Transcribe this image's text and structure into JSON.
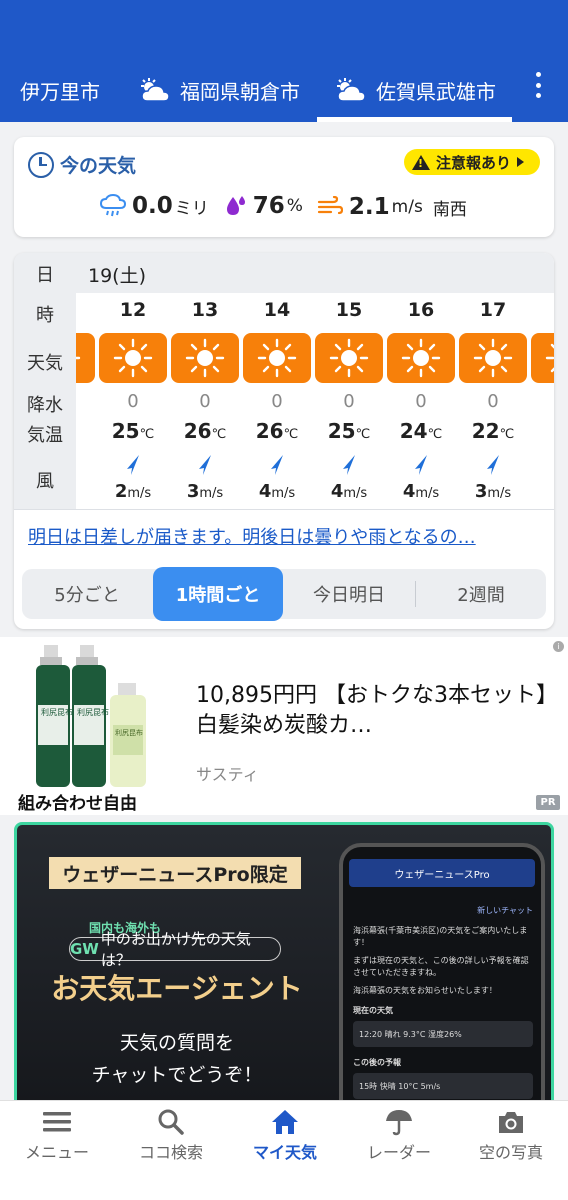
{
  "header": {
    "tabs": [
      {
        "label": "伊万里市"
      },
      {
        "label": "福岡県朝倉市"
      },
      {
        "label": "佐賀県武雄市"
      }
    ],
    "active_tab": 2,
    "accent": "#1f58c8"
  },
  "now": {
    "title": "今の天気",
    "alert": "注意報あり",
    "rain_value": "0.0",
    "rain_unit": "ミリ",
    "humidity_value": "76",
    "humidity_unit": "%",
    "wind_value": "2.1",
    "wind_unit": "m/s",
    "wind_dir": "南西"
  },
  "forecast": {
    "row_labels": {
      "day": "日",
      "hour": "時",
      "weather": "天気",
      "precip": "降水",
      "temp": "気温",
      "wind": "風"
    },
    "date": "19(土)",
    "hours": [
      {
        "hour": "12",
        "precip": "0",
        "temp": "25",
        "wind": "2",
        "icon": "sun-icon"
      },
      {
        "hour": "13",
        "precip": "0",
        "temp": "26",
        "wind": "3",
        "icon": "sun-icon"
      },
      {
        "hour": "14",
        "precip": "0",
        "temp": "26",
        "wind": "4",
        "icon": "sun-icon"
      },
      {
        "hour": "15",
        "precip": "0",
        "temp": "25",
        "wind": "4",
        "icon": "sun-icon"
      },
      {
        "hour": "16",
        "precip": "0",
        "temp": "24",
        "wind": "4",
        "icon": "sun-icon"
      },
      {
        "hour": "17",
        "precip": "0",
        "temp": "22",
        "wind": "3",
        "icon": "sun-icon"
      }
    ],
    "temp_unit": "℃",
    "wind_unit": "m/s",
    "summary_link": "明日は日差しが届きます。明後日は曇りや雨となるの…",
    "segments": [
      "5分ごと",
      "1時間ごと",
      "今日明日",
      "2週間"
    ],
    "active_segment": 1
  },
  "ad": {
    "title": "10,895円円 【おトクな3本セット】白髪染め炭酸カ…",
    "caption": "組み合わせ自由",
    "sponsor": "サスティ",
    "pr": "PR",
    "info": "i",
    "bottle_label": "利尻昆布"
  },
  "promo": {
    "badge": "ウェザーニュースPro限定",
    "tag": "国内も海外も",
    "question_em": "GW",
    "question": "中のお出かけ先の天気は？",
    "title": "お天気エージェント",
    "sub1": "天気の質問を",
    "sub2": "チャットでどうぞ！",
    "phone": {
      "app": "ウェザーニュースPro",
      "new_chat": "新しいチャット",
      "msg1": "海浜幕張(千葉市美浜区)の天気をご案内いたします！",
      "msg2": "まずは現在の天気と、この後の詳しい予報を確認させていただきますね。",
      "msg3": "海浜幕張の天気をお知らせいたします！",
      "current_label": "現在の天気",
      "current_row": "12:20  晴れ  9.3°C  湿度26%",
      "after_label": "この後の予報",
      "after_row": "15時  快晴  10°C  5m/s"
    }
  },
  "bottom_nav": [
    {
      "label": "メニュー",
      "icon": "menu-icon"
    },
    {
      "label": "ココ検索",
      "icon": "search-icon"
    },
    {
      "label": "マイ天気",
      "icon": "home-icon"
    },
    {
      "label": "レーダー",
      "icon": "umbrella-icon"
    },
    {
      "label": "空の写真",
      "icon": "camera-icon"
    }
  ],
  "active_nav": 2
}
